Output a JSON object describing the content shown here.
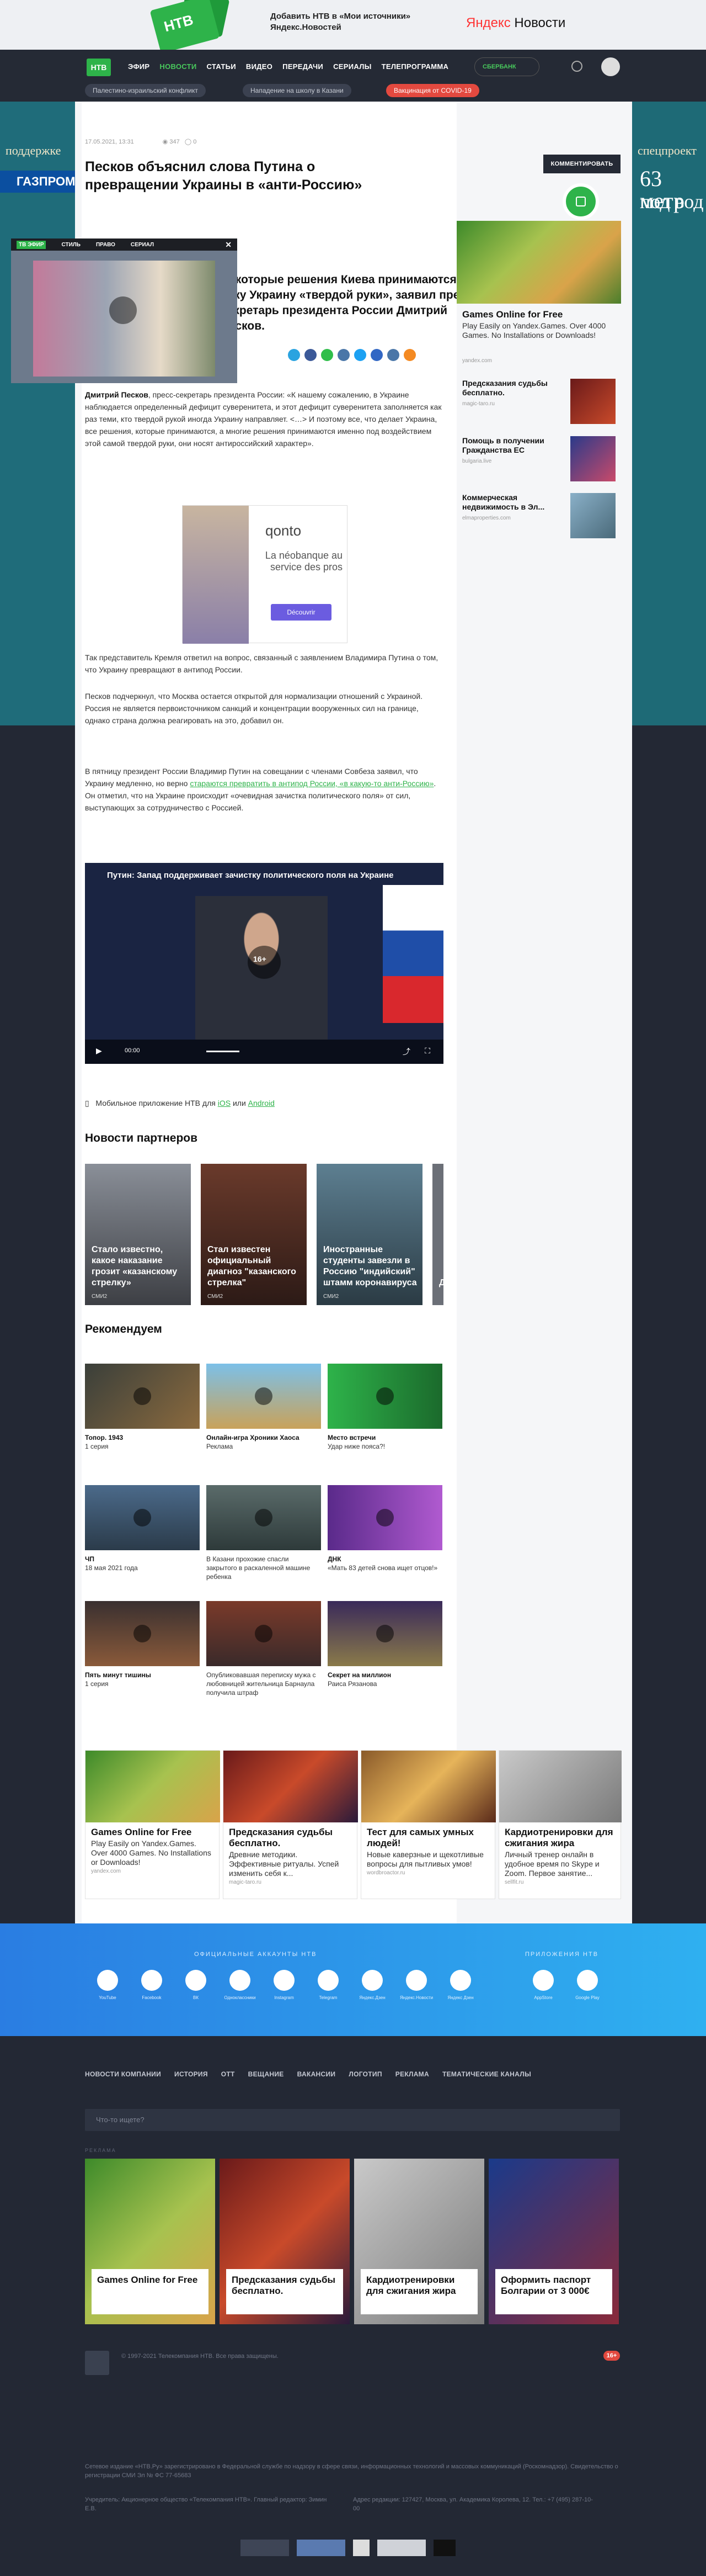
{
  "promo": {
    "logo_text": "НТВ",
    "text": "Добавить НТВ в «Мои источники» Яндекс.Новостей",
    "brand": "Яндекс",
    "brand2": "Новости"
  },
  "header": {
    "logo": "НТВ",
    "nav": [
      "ЭФИР",
      "НОВОСТИ",
      "СТАТЬИ",
      "ВИДЕО",
      "ПЕРЕДАЧИ",
      "СЕРИАЛЫ",
      "ТЕЛЕПРОГРАММА"
    ],
    "active_nav": "НОВОСТИ",
    "sber": "СБЕРБАНК"
  },
  "tags": [
    "Палестино-израильский конфликт",
    "Нападение на школу в Казани",
    "Вакцинация от COVID-19"
  ],
  "side_ads": {
    "left_1": "поддержке",
    "left_2": "ГАЗПРОМ",
    "right_1": "спецпроект",
    "right_2": "63 метр",
    "right_3": "под вод"
  },
  "article": {
    "meta_date": "17.05.2021, 13:31",
    "views": "347",
    "comments": "0",
    "title": "Песков объяснил слова Путина о превращении Украины в «анти-Россию»",
    "comment_button": "КОММЕНТИРОВАТЬ",
    "lead": "Некоторые решения Киева принимаются под руку Украину «твердой руки», заявил пресс-секретарь президента России Дмитрий Песков.",
    "p1_name": "Дмитрий Песков",
    "p1": ", пресс-секретарь президента России: «К нашему сожалению, в Украине наблюдается определенный дефицит суверенитета, и этот дефицит суверенитета заполняется как раз теми, кто твердой рукой иногда Украину направляет. <…> И поэтому все, что делает Украина, все решения, которые принимаются, а многие решения принимаются именно под воздействием этой самой твердой руки, они носят антироссийский характер».",
    "p2": "Так представитель Кремля ответил на вопрос, связанный с заявлением Владимира Путина о том, что Украину превращают в антипод России.",
    "p3": "Песков подчеркнул, что Москва остается открытой для нормализации отношений с Украиной. Россия не является первоисточником санкций и концентрации вооруженных сил на границе, однако страна должна реагировать на это, добавил он.",
    "p4_a": "В пятницу президент России Владимир Путин на совещании с членами Совбеза заявил, что Украину медленно, но верно ",
    "p4_link": "стараются превратить в антипод России, «в какую-то анти-Россию»",
    "p4_b": ". Он отметил, что на Украине происходит «очевидная зачистка политического поля» от сил, выступающих за сотрудничество с Россией.",
    "app_text": "Мобильное приложение НТВ для ",
    "app_ios": "iOS",
    "app_or": " или ",
    "app_android": "Android"
  },
  "floating_video": {
    "tabs": [
      "ТВ ЭФИР",
      "СТИЛЬ",
      "ПРАВО",
      "СЕРИАЛ"
    ],
    "close": "✕"
  },
  "ad_qonto": {
    "brand": "qonto",
    "text": "La néobanque au service des pros",
    "button": "Découvrir"
  },
  "video": {
    "title": "Путин: Запад поддерживает зачистку политического поля на Украине",
    "age": "16+",
    "time": "00:00"
  },
  "partners": {
    "title": "Новости партнеров",
    "items": [
      {
        "caption": "Стало известно, какое наказание грозит «казанскому стрелку»",
        "source": "СМИ2"
      },
      {
        "caption": "Стал известен официальный диагноз \"казанского стрелка\"",
        "source": "СМИ2"
      },
      {
        "caption": "Иностранные студенты завезли в Россию \"индийский\" штамм коронавируса",
        "source": "СМИ2"
      },
      {
        "caption": "Д...",
        "source": ""
      }
    ]
  },
  "recommend": {
    "title": "Рекомендуем",
    "items": [
      {
        "title": "Топор. 1943",
        "sub": "1 серия"
      },
      {
        "title": "Онлайн-игра Хроники Хаоса",
        "sub": "Реклама"
      },
      {
        "title": "Место встречи",
        "sub": "Удар ниже пояса?!"
      },
      {
        "title": "ЧП",
        "sub": "18 мая 2021 года"
      },
      {
        "title": "",
        "sub": "В Казани прохожие спасли закрытого в раскаленной машине ребенка"
      },
      {
        "title": "ДНК",
        "sub": "«Мать 83 детей снова ищет отцов!»"
      },
      {
        "title": "Пять минут тишины",
        "sub": "1 серия"
      },
      {
        "title": "",
        "sub": "Опубликовавшая переписку мужа с любовницей жительница Барнаула получила штраф"
      },
      {
        "title": "Секрет на миллион",
        "sub": "Раиса Рязанова"
      }
    ]
  },
  "bottom_ads": [
    {
      "title": "Games Online for Free",
      "sub": "Play Easily on Yandex.Games. Over 4000 Games. No Installations or Downloads!",
      "domain": "yandex.com"
    },
    {
      "title": "Предсказания судьбы бесплатно.",
      "sub": "Древние методики. Эффективные ритуалы. Успей изменить себя к...",
      "domain": "magic-taro.ru"
    },
    {
      "title": "Тест для самых умных людей!",
      "sub": "Новые каверзные и щекотливые вопросы для пытливых умов!",
      "domain": "wordbroactor.ru"
    },
    {
      "title": "Кардиотренировки для сжигания жира",
      "sub": "Личный тренер онлайн в удобное время по Skype и Zoom. Первое занятие...",
      "domain": "sellfit.ru"
    }
  ],
  "aside": {
    "main_title": "Games Online for Free",
    "main_sub": "Play Easily on Yandex.Games. Over 4000 Games. No Installations or Downloads!",
    "main_domain": "yandex.com",
    "rows": [
      {
        "title": "Предсказания судьбы бесплатно.",
        "domain": "magic-taro.ru"
      },
      {
        "title": "Помощь в получении Гражданства ЕС",
        "domain": "bulgaria.live"
      },
      {
        "title": "Коммерческая недвижимость в Эл...",
        "domain": "elmaproperties.com"
      }
    ]
  },
  "social": {
    "accounts_title": "ОФИЦИАЛЬНЫЕ АККАУНТЫ НТВ",
    "apps_title": "ПРИЛОЖЕНИЯ НТВ",
    "accounts": [
      "YouTube",
      "Facebook",
      "ВК",
      "Одноклассники",
      "Instagram",
      "Telegram",
      "Яндекс.Дзен",
      "Яндекс.Новости",
      "Яндекс Дзен"
    ],
    "apps": [
      "AppStore",
      "Google Play"
    ]
  },
  "footer": {
    "nav": [
      "НОВОСТИ КОМПАНИИ",
      "ИСТОРИЯ",
      "ОТТ",
      "ВЕЩАНИЕ",
      "ВАКАНСИИ",
      "ЛОГОТИП",
      "РЕКЛАМА",
      "ТЕМАТИЧЕСКИЕ КАНАЛЫ"
    ],
    "search_placeholder": "Что-то ищете?",
    "ad_label": "РЕКЛАМА",
    "cards": [
      "Games Online for Free",
      "Предсказания судьбы бесплатно.",
      "Кардиотренировки для сжигания жира",
      "Оформить паспорт Болгарии от 3 000€"
    ],
    "copyright": "© 1997-2021 Телекомпания НТВ. Все права защищены.",
    "legal": "Сетевое издание «НТВ.Ру» зарегистрировано в Федеральной службе по надзору в сфере связи, информационных технологий и массовых коммуникаций (Роскомнадзор). Свидетельство о регистрации СМИ Эл № ФС 77-65683",
    "contacts_left": "Учредитель: Акционерное общество «Телекомпания НТВ». Главный редактор: Зимин Е.В.",
    "contacts_right": "Адрес редакции: 127427, Москва, ул. Академика Королева, 12. Тел.: +7 (495) 287-10-00",
    "age": "16+"
  }
}
